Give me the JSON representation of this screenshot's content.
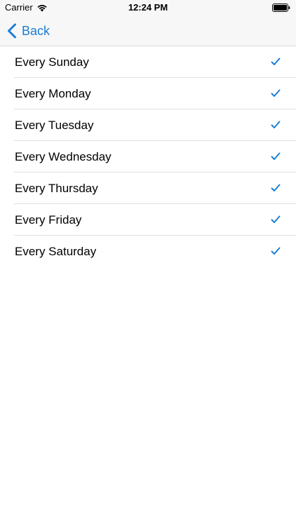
{
  "status_bar": {
    "carrier": "Carrier",
    "time": "12:24 PM"
  },
  "nav": {
    "back_label": "Back"
  },
  "accent_color": "#1a7ed6",
  "icons": {
    "wifi": "wifi-icon",
    "battery": "battery-icon",
    "back": "chevron-left-icon",
    "check": "checkmark-icon"
  },
  "days": [
    {
      "label": "Every Sunday",
      "checked": true
    },
    {
      "label": "Every Monday",
      "checked": true
    },
    {
      "label": "Every Tuesday",
      "checked": true
    },
    {
      "label": "Every Wednesday",
      "checked": true
    },
    {
      "label": "Every Thursday",
      "checked": true
    },
    {
      "label": "Every Friday",
      "checked": true
    },
    {
      "label": "Every Saturday",
      "checked": true
    }
  ]
}
